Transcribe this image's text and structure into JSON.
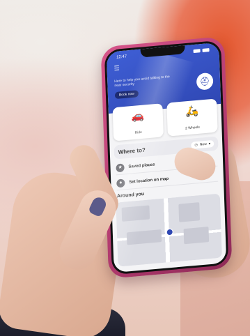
{
  "status_bar": {
    "time": "12:47"
  },
  "header": {
    "menu_icon": "hamburger-icon",
    "promo_text": "Here to help you avoid talking to the near security",
    "promo_button": "Book now",
    "badge_icon": "seatbelt-icon"
  },
  "options": [
    {
      "label": "Ride",
      "icon": "car-icon"
    },
    {
      "label": "2 Wheels",
      "icon": "scooter-icon"
    }
  ],
  "where_to": {
    "label": "Where to?",
    "time_button": "Now"
  },
  "rows": [
    {
      "label": "Saved places",
      "icon": "star-icon"
    },
    {
      "label": "Set location on map",
      "icon": "pin-icon"
    }
  ],
  "around": {
    "title": "Around you"
  }
}
